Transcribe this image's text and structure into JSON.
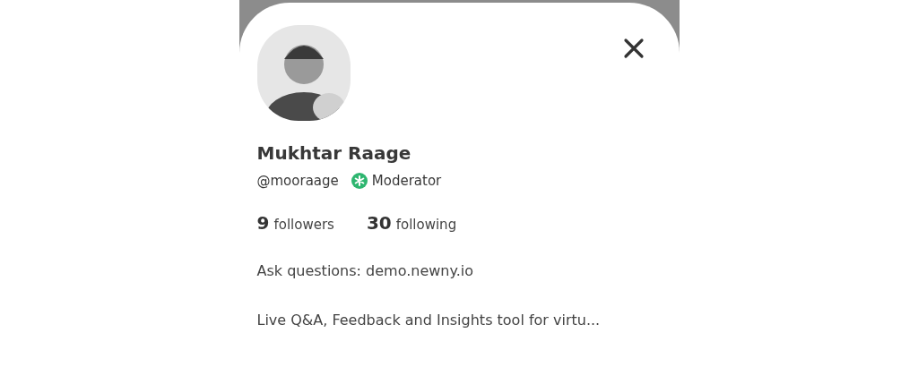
{
  "profile": {
    "name": "Mukhtar Raage",
    "handle": "@mooraage",
    "role_badge": "Moderator",
    "stats": [
      {
        "count": "9",
        "label": "followers"
      },
      {
        "count": "30",
        "label": "following"
      }
    ],
    "bio": [
      "Ask questions: demo.newny.io",
      "Live Q&A, Feedback and Insights tool for virtu..."
    ]
  }
}
